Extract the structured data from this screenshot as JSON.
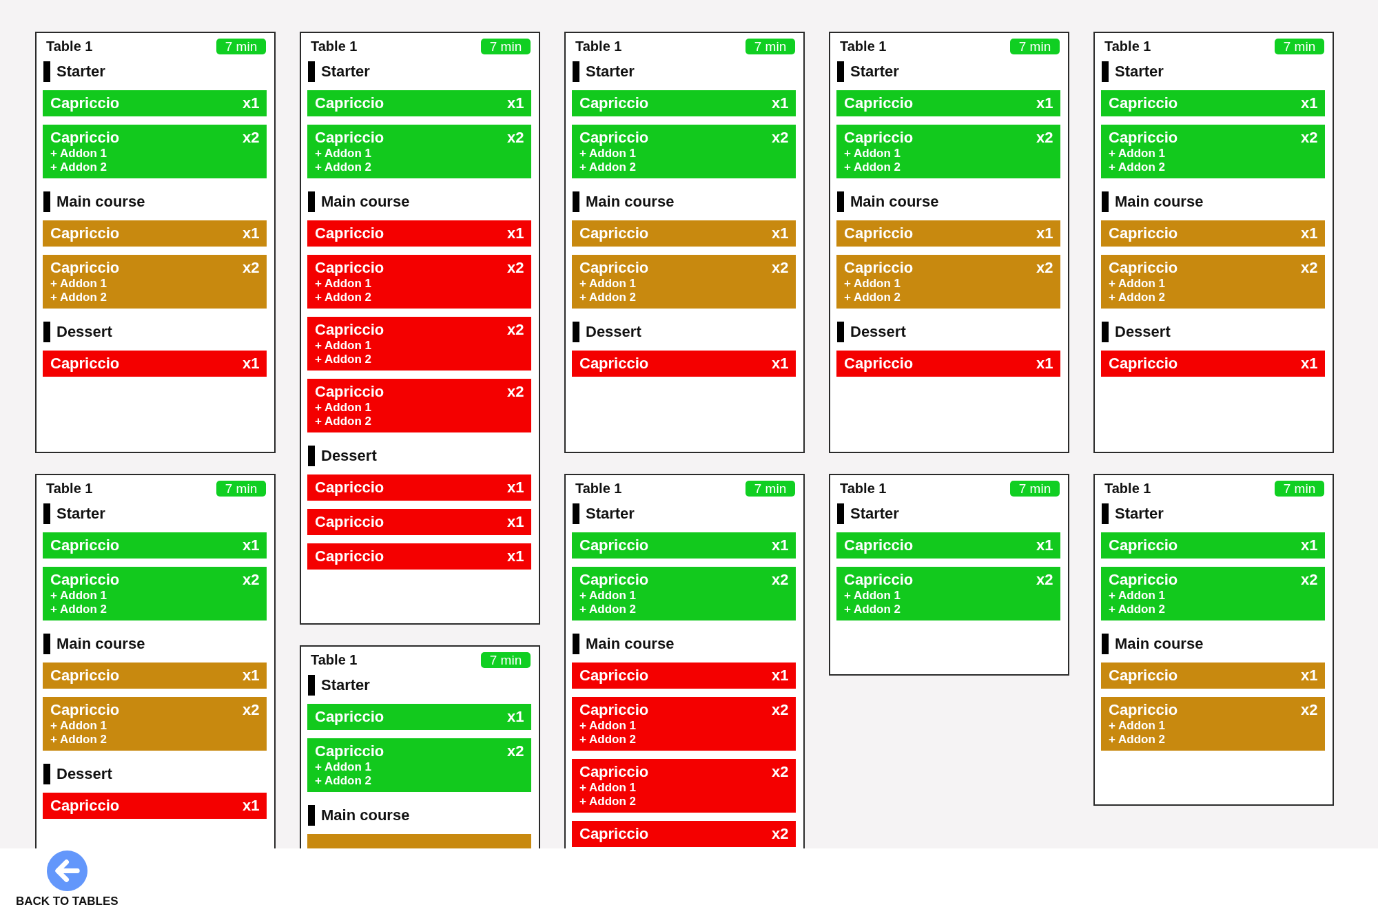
{
  "columns": [
    {
      "tickets": [
        {
          "title": "Table 1",
          "timer": "7 min",
          "sections": [
            {
              "title": "Starter",
              "items": [
                {
                  "name": "Capriccio",
                  "quantity": "x1",
                  "color": "#12c91d"
                },
                {
                  "name": "Capriccio",
                  "quantity": "x2",
                  "addons": [
                    "+ Addon 1",
                    "+ Addon 2"
                  ],
                  "color": "#12c91d"
                }
              ]
            },
            {
              "title": "Main course",
              "items": [
                {
                  "name": "Capriccio",
                  "quantity": "x1",
                  "color": "#c8890f"
                },
                {
                  "name": "Capriccio",
                  "quantity": "x2",
                  "addons": [
                    "+ Addon 1",
                    "+ Addon 2"
                  ],
                  "color": "#c8890f"
                }
              ]
            },
            {
              "title": "Dessert",
              "items": [
                {
                  "name": "Capriccio",
                  "quantity": "x1",
                  "color": "#f40000"
                }
              ]
            }
          ]
        },
        {
          "title": "Table 1",
          "timer": "7 min",
          "sections": [
            {
              "title": "Starter",
              "items": [
                {
                  "name": "Capriccio",
                  "quantity": "x1",
                  "color": "#12c91d"
                },
                {
                  "name": "Capriccio",
                  "quantity": "x2",
                  "addons": [
                    "+ Addon 1",
                    "+ Addon 2"
                  ],
                  "color": "#12c91d"
                }
              ]
            },
            {
              "title": "Main course",
              "items": [
                {
                  "name": "Capriccio",
                  "quantity": "x1",
                  "color": "#c8890f"
                },
                {
                  "name": "Capriccio",
                  "quantity": "x2",
                  "addons": [
                    "+ Addon 1",
                    "+ Addon 2"
                  ],
                  "color": "#c8890f"
                }
              ]
            },
            {
              "title": "Dessert",
              "items": [
                {
                  "name": "Capriccio",
                  "quantity": "x1",
                  "color": "#f40000"
                }
              ]
            }
          ]
        }
      ]
    },
    {
      "tickets": [
        {
          "title": "Table 1",
          "timer": "7 min",
          "sections": [
            {
              "title": "Starter",
              "items": [
                {
                  "name": "Capriccio",
                  "quantity": "x1",
                  "color": "#12c91d"
                },
                {
                  "name": "Capriccio",
                  "quantity": "x2",
                  "addons": [
                    "+ Addon 1",
                    "+ Addon 2"
                  ],
                  "color": "#12c91d"
                }
              ]
            },
            {
              "title": "Main course",
              "items": [
                {
                  "name": "Capriccio",
                  "quantity": "x1",
                  "color": "#f40000"
                },
                {
                  "name": "Capriccio",
                  "quantity": "x2",
                  "addons": [
                    "+ Addon 1",
                    "+ Addon 2"
                  ],
                  "color": "#f40000"
                },
                {
                  "name": "Capriccio",
                  "quantity": "x2",
                  "addons": [
                    "+ Addon 1",
                    "+ Addon 2"
                  ],
                  "color": "#f40000"
                },
                {
                  "name": "Capriccio",
                  "quantity": "x2",
                  "addons": [
                    "+ Addon 1",
                    "+ Addon 2"
                  ],
                  "color": "#f40000"
                }
              ]
            },
            {
              "title": "Dessert",
              "items": [
                {
                  "name": "Capriccio",
                  "quantity": "x1",
                  "color": "#f40000"
                },
                {
                  "name": "Capriccio",
                  "quantity": "x1",
                  "color": "#f40000"
                },
                {
                  "name": "Capriccio",
                  "quantity": "x1",
                  "color": "#f40000"
                }
              ]
            }
          ]
        },
        {
          "title": "Table 1",
          "timer": "7 min",
          "sections": [
            {
              "title": "Starter",
              "items": [
                {
                  "name": "Capriccio",
                  "quantity": "x1",
                  "color": "#12c91d"
                },
                {
                  "name": "Capriccio",
                  "quantity": "x2",
                  "addons": [
                    "+ Addon 1",
                    "+ Addon 2"
                  ],
                  "color": "#12c91d"
                }
              ]
            },
            {
              "title": "Main course",
              "items": [
                {
                  "color": "#c8890f"
                }
              ]
            }
          ]
        }
      ]
    },
    {
      "tickets": [
        {
          "title": "Table 1",
          "timer": "7 min",
          "sections": [
            {
              "title": "Starter",
              "items": [
                {
                  "name": "Capriccio",
                  "quantity": "x1",
                  "color": "#12c91d"
                },
                {
                  "name": "Capriccio",
                  "quantity": "x2",
                  "addons": [
                    "+ Addon 1",
                    "+ Addon 2"
                  ],
                  "color": "#12c91d"
                }
              ]
            },
            {
              "title": "Main course",
              "items": [
                {
                  "name": "Capriccio",
                  "quantity": "x1",
                  "color": "#c8890f"
                },
                {
                  "name": "Capriccio",
                  "quantity": "x2",
                  "addons": [
                    "+ Addon 1",
                    "+ Addon 2"
                  ],
                  "color": "#c8890f"
                }
              ]
            },
            {
              "title": "Dessert",
              "items": [
                {
                  "name": "Capriccio",
                  "quantity": "x1",
                  "color": "#f40000"
                }
              ]
            }
          ]
        },
        {
          "title": "Table 1",
          "timer": "7 min",
          "sections": [
            {
              "title": "Starter",
              "items": [
                {
                  "name": "Capriccio",
                  "quantity": "x1",
                  "color": "#12c91d"
                },
                {
                  "name": "Capriccio",
                  "quantity": "x2",
                  "addons": [
                    "+ Addon 1",
                    "+ Addon 2"
                  ],
                  "color": "#12c91d"
                }
              ]
            },
            {
              "title": "Main course",
              "items": [
                {
                  "name": "Capriccio",
                  "quantity": "x1",
                  "color": "#f40000"
                },
                {
                  "name": "Capriccio",
                  "quantity": "x2",
                  "addons": [
                    "+ Addon 1",
                    "+ Addon 2"
                  ],
                  "color": "#f40000"
                },
                {
                  "name": "Capriccio",
                  "quantity": "x2",
                  "addons": [
                    "+ Addon 1",
                    "+ Addon 2"
                  ],
                  "color": "#f40000"
                },
                {
                  "name": "Capriccio",
                  "quantity": "x2",
                  "color": "#f40000"
                }
              ]
            }
          ]
        }
      ]
    },
    {
      "tickets": [
        {
          "title": "Table 1",
          "timer": "7 min",
          "sections": [
            {
              "title": "Starter",
              "items": [
                {
                  "name": "Capriccio",
                  "quantity": "x1",
                  "color": "#12c91d"
                },
                {
                  "name": "Capriccio",
                  "quantity": "x2",
                  "addons": [
                    "+ Addon 1",
                    "+ Addon 2"
                  ],
                  "color": "#12c91d"
                }
              ]
            },
            {
              "title": "Main course",
              "items": [
                {
                  "name": "Capriccio",
                  "quantity": "x1",
                  "color": "#c8890f"
                },
                {
                  "name": "Capriccio",
                  "quantity": "x2",
                  "addons": [
                    "+ Addon 1",
                    "+ Addon 2"
                  ],
                  "color": "#c8890f"
                }
              ]
            },
            {
              "title": "Dessert",
              "items": [
                {
                  "name": "Capriccio",
                  "quantity": "x1",
                  "color": "#f40000"
                }
              ]
            }
          ]
        },
        {
          "title": "Table 1",
          "timer": "7 min",
          "sections": [
            {
              "title": "Starter",
              "items": [
                {
                  "name": "Capriccio",
                  "quantity": "x1",
                  "color": "#12c91d"
                },
                {
                  "name": "Capriccio",
                  "quantity": "x2",
                  "addons": [
                    "+ Addon 1",
                    "+ Addon 2"
                  ],
                  "color": "#12c91d"
                }
              ]
            }
          ]
        }
      ]
    },
    {
      "tickets": [
        {
          "title": "Table 1",
          "timer": "7 min",
          "sections": [
            {
              "title": "Starter",
              "items": [
                {
                  "name": "Capriccio",
                  "quantity": "x1",
                  "color": "#12c91d"
                },
                {
                  "name": "Capriccio",
                  "quantity": "x2",
                  "addons": [
                    "+ Addon 1",
                    "+ Addon 2"
                  ],
                  "color": "#12c91d"
                }
              ]
            },
            {
              "title": "Main course",
              "items": [
                {
                  "name": "Capriccio",
                  "quantity": "x1",
                  "color": "#c8890f"
                },
                {
                  "name": "Capriccio",
                  "quantity": "x2",
                  "addons": [
                    "+ Addon 1",
                    "+ Addon 2"
                  ],
                  "color": "#c8890f"
                }
              ]
            },
            {
              "title": "Dessert",
              "items": [
                {
                  "name": "Capriccio",
                  "quantity": "x1",
                  "color": "#f40000"
                }
              ]
            }
          ]
        },
        {
          "title": "Table 1",
          "timer": "7 min",
          "sections": [
            {
              "title": "Starter",
              "items": [
                {
                  "name": "Capriccio",
                  "quantity": "x1",
                  "color": "#12c91d"
                },
                {
                  "name": "Capriccio",
                  "quantity": "x2",
                  "addons": [
                    "+ Addon 1",
                    "+ Addon 2"
                  ],
                  "color": "#12c91d"
                }
              ]
            },
            {
              "title": "Main course",
              "items": [
                {
                  "name": "Capriccio",
                  "quantity": "x1",
                  "color": "#c8890f"
                },
                {
                  "name": "Capriccio",
                  "quantity": "x2",
                  "addons": [
                    "+ Addon 1",
                    "+ Addon 2"
                  ],
                  "color": "#c8890f"
                }
              ]
            }
          ]
        }
      ]
    }
  ],
  "footer": {
    "back_button": "BACK TO TABLES"
  }
}
